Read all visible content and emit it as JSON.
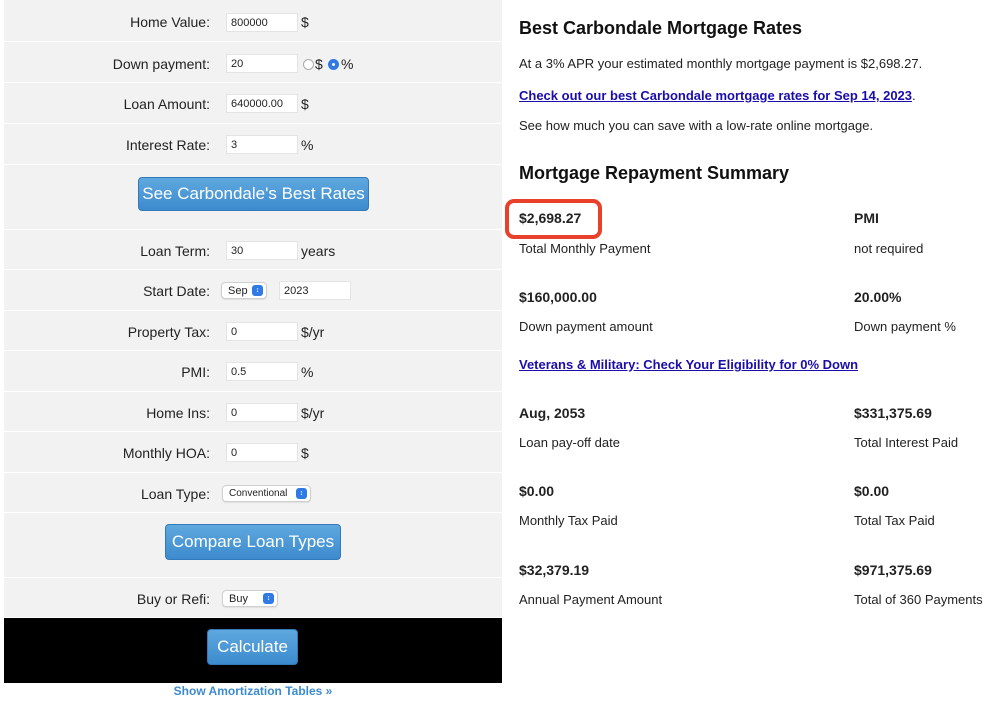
{
  "calculator": {
    "home_value": {
      "label": "Home Value:",
      "value": "800000",
      "unit": "$"
    },
    "down_payment": {
      "label": "Down payment:",
      "value": "20",
      "unit_dollar": "$",
      "unit_percent": "%",
      "selected_unit": "%"
    },
    "loan_amount": {
      "label": "Loan Amount:",
      "value": "640000.00",
      "unit": "$"
    },
    "interest_rate": {
      "label": "Interest Rate:",
      "value": "3",
      "unit": "%"
    },
    "best_rates_button": "See Carbondale's Best Rates",
    "loan_term": {
      "label": "Loan Term:",
      "value": "30",
      "unit": "years"
    },
    "start_date": {
      "label": "Start Date:",
      "month": "Sep",
      "year": "2023"
    },
    "property_tax": {
      "label": "Property Tax:",
      "value": "0",
      "unit": "$/yr"
    },
    "pmi": {
      "label": "PMI:",
      "value": "0.5",
      "unit": "%"
    },
    "home_ins": {
      "label": "Home Ins:",
      "value": "0",
      "unit": "$/yr"
    },
    "monthly_hoa": {
      "label": "Monthly HOA:",
      "value": "0",
      "unit": "$"
    },
    "loan_type": {
      "label": "Loan Type:",
      "value": "Conventional"
    },
    "compare_button": "Compare Loan Types",
    "buy_or_refi": {
      "label": "Buy or Refi:",
      "value": "Buy"
    },
    "calculate_button": "Calculate",
    "amortization_link": "Show Amortization Tables »"
  },
  "results": {
    "title": "Best Carbondale Mortgage Rates",
    "estimate_text": "At a 3% APR your estimated monthly mortgage payment is $2,698.27.",
    "rates_link": "Check out our best Carbondale mortgage rates for Sep 14, 2023",
    "rates_link_suffix": ".",
    "savings_text": "See how much you can save with a low-rate online mortgage.",
    "summary_title": "Mortgage Repayment Summary",
    "total_monthly_payment": {
      "value": "$2,698.27",
      "label": "Total Monthly Payment"
    },
    "pmi": {
      "value": "PMI",
      "label": "not required"
    },
    "down_payment_amount": {
      "value": "$160,000.00",
      "label": "Down payment amount"
    },
    "down_payment_percent": {
      "value": "20.00%",
      "label": "Down payment %"
    },
    "veterans_link": "Veterans & Military: Check Your Eligibility for 0% Down",
    "payoff_date": {
      "value": "Aug, 2053",
      "label": "Loan pay-off date"
    },
    "total_interest": {
      "value": "$331,375.69",
      "label": "Total Interest Paid"
    },
    "monthly_tax": {
      "value": "$0.00",
      "label": "Monthly Tax Paid"
    },
    "total_tax": {
      "value": "$0.00",
      "label": "Total Tax Paid"
    },
    "annual_payment": {
      "value": "$32,379.19",
      "label": "Annual Payment Amount"
    },
    "total_payments": {
      "value": "$971,375.69",
      "label": "Total of 360 Payments"
    }
  },
  "colors": {
    "button_blue": "#3d8bce",
    "highlight_red": "#e8402a",
    "link_blue": "#1a0dab"
  }
}
